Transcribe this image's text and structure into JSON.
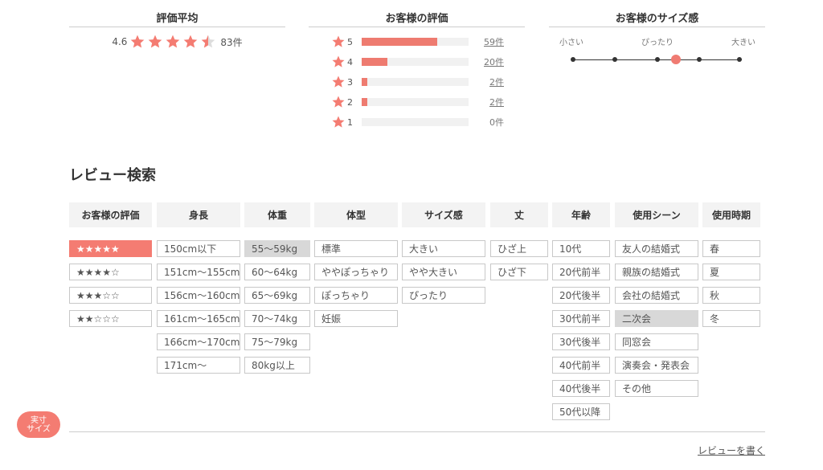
{
  "average": {
    "title": "評価平均",
    "score": "4.6",
    "count": "83件",
    "stars_filled": 4.5,
    "star_color": "#f47c72"
  },
  "rating": {
    "title": "お客様の評価",
    "rows": [
      {
        "star": "5",
        "fraction": 0.71,
        "count": "59件"
      },
      {
        "star": "4",
        "fraction": 0.24,
        "count": "20件"
      },
      {
        "star": "3",
        "fraction": 0.05,
        "count": "2件"
      },
      {
        "star": "2",
        "fraction": 0.05,
        "count": "2件"
      },
      {
        "star": "1",
        "fraction": 0.0,
        "count": "0件"
      }
    ]
  },
  "size_feel": {
    "title": "お客様のサイズ感",
    "label_small": "小さい",
    "label_fit": "ぴったり",
    "label_large": "大きい",
    "selected_index": 3
  },
  "search": {
    "title": "レビュー検索",
    "columns": {
      "rating": {
        "label": "お客様の評価",
        "options": [
          "★★★★★",
          "★★★★☆",
          "★★★☆☆",
          "★★☆☆☆"
        ]
      },
      "height": {
        "label": "身長",
        "options": [
          "150cm以下",
          "151cm〜155cm",
          "156cm〜160cm",
          "161cm〜165cm",
          "166cm〜170cm",
          "171cm〜"
        ]
      },
      "weight": {
        "label": "体重",
        "options": [
          "55〜59kg",
          "60〜64kg",
          "65〜69kg",
          "70〜74kg",
          "75〜79kg",
          "80kg以上"
        ]
      },
      "body": {
        "label": "体型",
        "options": [
          "標準",
          "ややぽっちゃり",
          "ぽっちゃり",
          "妊娠"
        ]
      },
      "size": {
        "label": "サイズ感",
        "options": [
          "大きい",
          "やや大きい",
          "ぴったり"
        ]
      },
      "length": {
        "label": "丈",
        "options": [
          "ひざ上",
          "ひざ下"
        ]
      },
      "age": {
        "label": "年齢",
        "options": [
          "10代",
          "20代前半",
          "20代後半",
          "30代前半",
          "30代後半",
          "40代前半",
          "40代後半",
          "50代以降"
        ]
      },
      "scene": {
        "label": "使用シーン",
        "options": [
          "友人の結婚式",
          "親族の結婚式",
          "会社の結婚式",
          "二次会",
          "同窓会",
          "演奏会・発表会",
          "その他"
        ]
      },
      "season": {
        "label": "使用時期",
        "options": [
          "春",
          "夏",
          "秋",
          "冬"
        ]
      }
    }
  },
  "footer": {
    "write_review": "レビューを書く",
    "badge_line1": "実寸",
    "badge_line2": "サイズ"
  }
}
